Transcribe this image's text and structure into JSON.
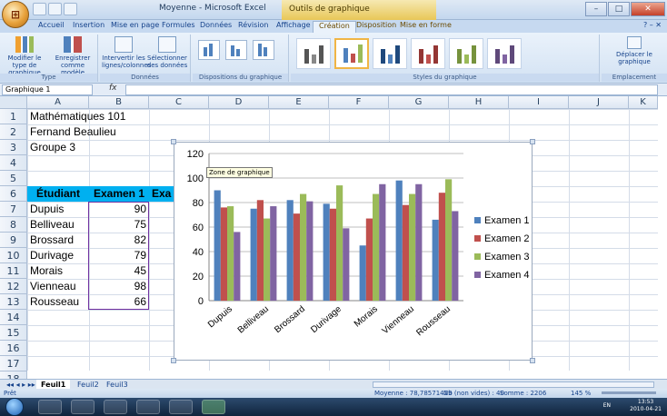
{
  "window": {
    "title": "Moyenne - Microsoft Excel",
    "context_title": "Outils de graphique",
    "minimize": "–",
    "maximize": "□",
    "close": "✕"
  },
  "tabs": [
    "Accueil",
    "Insertion",
    "Mise en page",
    "Formules",
    "Données",
    "Révision",
    "Affichage",
    "Création",
    "Disposition",
    "Mise en forme"
  ],
  "active_tab": "Création",
  "ribbon": {
    "groups": {
      "type": "Type",
      "donnees": "Données",
      "dispositions": "Dispositions du graphique",
      "styles": "Styles du graphique",
      "emplacement": "Emplacement"
    },
    "buttons": {
      "change_type": "Modifier le type de graphique",
      "save_template": "Enregistrer comme modèle",
      "switch_rows": "Intervertir les lignes/colonnes",
      "select_data": "Sélectionner des données",
      "move_chart": "Déplacer le graphique"
    }
  },
  "formula_bar": {
    "name_box": "Graphique 1",
    "fx": "fx"
  },
  "columns": [
    "A",
    "B",
    "C",
    "D",
    "E",
    "F",
    "G",
    "H",
    "I",
    "J",
    "K"
  ],
  "rows": [
    "1",
    "2",
    "3",
    "4",
    "5",
    "6",
    "7",
    "8",
    "9",
    "10",
    "11",
    "12",
    "13",
    "14",
    "15",
    "16",
    "17",
    "18"
  ],
  "cells": {
    "a1": "Mathématiques 101",
    "a2": "Fernand Beaulieu",
    "a3": "Groupe 3",
    "header_student": "Étudiant",
    "header_exam1": "Examen 1",
    "header_exam2_partial": "Exa",
    "students": [
      "Dupuis",
      "Belliveau",
      "Brossard",
      "Durivage",
      "Morais",
      "Vienneau",
      "Rousseau"
    ],
    "exam1": [
      "90",
      "75",
      "82",
      "79",
      "45",
      "98",
      "66"
    ]
  },
  "chart_tooltip": "Zone de graphique",
  "chart_data": {
    "type": "bar",
    "categories": [
      "Dupuis",
      "Belliveau",
      "Brossard",
      "Durivage",
      "Morais",
      "Vienneau",
      "Rousseau"
    ],
    "series": [
      {
        "name": "Examen 1",
        "values": [
          90,
          75,
          82,
          79,
          45,
          98,
          66
        ],
        "color": "#4f81bd"
      },
      {
        "name": "Examen 2",
        "values": [
          76,
          82,
          71,
          75,
          67,
          78,
          88
        ],
        "color": "#c0504d"
      },
      {
        "name": "Examen 3",
        "values": [
          77,
          67,
          87,
          94,
          87,
          87,
          99
        ],
        "color": "#9bbb59"
      },
      {
        "name": "Examen 4",
        "values": [
          56,
          77,
          81,
          59,
          95,
          95,
          73
        ],
        "color": "#8064a2"
      }
    ],
    "yticks": [
      "0",
      "20",
      "40",
      "60",
      "80",
      "100",
      "120"
    ],
    "ylim": [
      0,
      120
    ],
    "legend_position": "right",
    "grid": true
  },
  "sheets": [
    "Feuil1",
    "Feuil2",
    "Feuil3"
  ],
  "active_sheet": "Feuil1",
  "status": {
    "ready": "Prêt",
    "average": "Moyenne : 78,78571429",
    "count": "Nb (non vides) : 40",
    "sum": "Somme : 2206",
    "zoom": "145 %"
  },
  "taskbar": {
    "lang": "EN",
    "time": "13:53",
    "date": "2010-04-21"
  }
}
